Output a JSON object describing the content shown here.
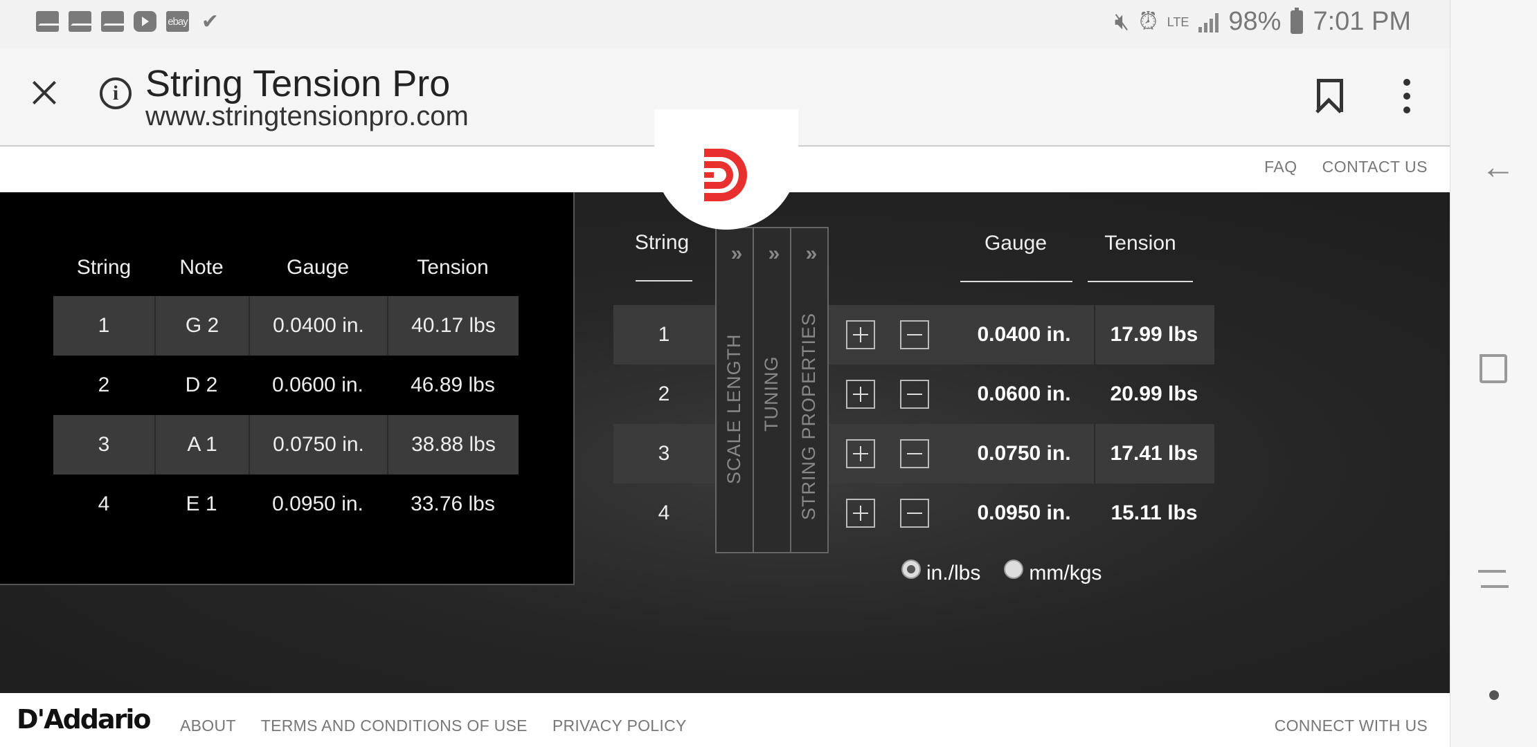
{
  "status_bar": {
    "notifications": [
      "mail-icon",
      "mail-icon",
      "mail-icon",
      "youtube-icon",
      "ebay-icon",
      "tasks-icon"
    ],
    "ebay_text": "ebay",
    "lte": "LTE",
    "battery_percent": "98%",
    "time": "7:01 PM"
  },
  "browser": {
    "title": "String Tension Pro",
    "url": "www.stringtensionpro.com"
  },
  "header": {
    "faq": "FAQ",
    "contact": "CONTACT US"
  },
  "left_table": {
    "headers": [
      "String",
      "Note",
      "Gauge",
      "Tension"
    ],
    "rows": [
      {
        "string": "1",
        "note": "G 2",
        "gauge": "0.0400 in.",
        "tension": "40.17 lbs"
      },
      {
        "string": "2",
        "note": "D 2",
        "gauge": "0.0600 in.",
        "tension": "46.89 lbs"
      },
      {
        "string": "3",
        "note": "A 1",
        "gauge": "0.0750 in.",
        "tension": "38.88 lbs"
      },
      {
        "string": "4",
        "note": "E 1",
        "gauge": "0.0950 in.",
        "tension": "33.76 lbs"
      }
    ]
  },
  "right_table": {
    "header_string": "String",
    "header_gauge": "Gauge",
    "header_tension": "Tension",
    "tabs": [
      "SCALE LENGTH",
      "TUNING",
      "STRING PROPERTIES"
    ],
    "tab_chevron": "»",
    "rows": [
      {
        "string": "1",
        "gauge": "0.0400 in.",
        "tension": "17.99 lbs"
      },
      {
        "string": "2",
        "gauge": "0.0600 in.",
        "tension": "20.99 lbs"
      },
      {
        "string": "3",
        "gauge": "0.0750 in.",
        "tension": "17.41 lbs"
      },
      {
        "string": "4",
        "gauge": "0.0950 in.",
        "tension": "15.11 lbs"
      }
    ],
    "units": {
      "option1": "in./lbs",
      "option2": "mm/kgs",
      "selected": "in./lbs"
    }
  },
  "footer": {
    "brand": "D'Addario",
    "about": "ABOUT",
    "terms": "TERMS AND CONDITIONS OF USE",
    "privacy": "PRIVACY POLICY",
    "connect": "CONNECT WITH US"
  },
  "colors": {
    "brand_red": "#e8302e",
    "panel_dark": "#262626",
    "row_shade": "#3b3b3b"
  }
}
